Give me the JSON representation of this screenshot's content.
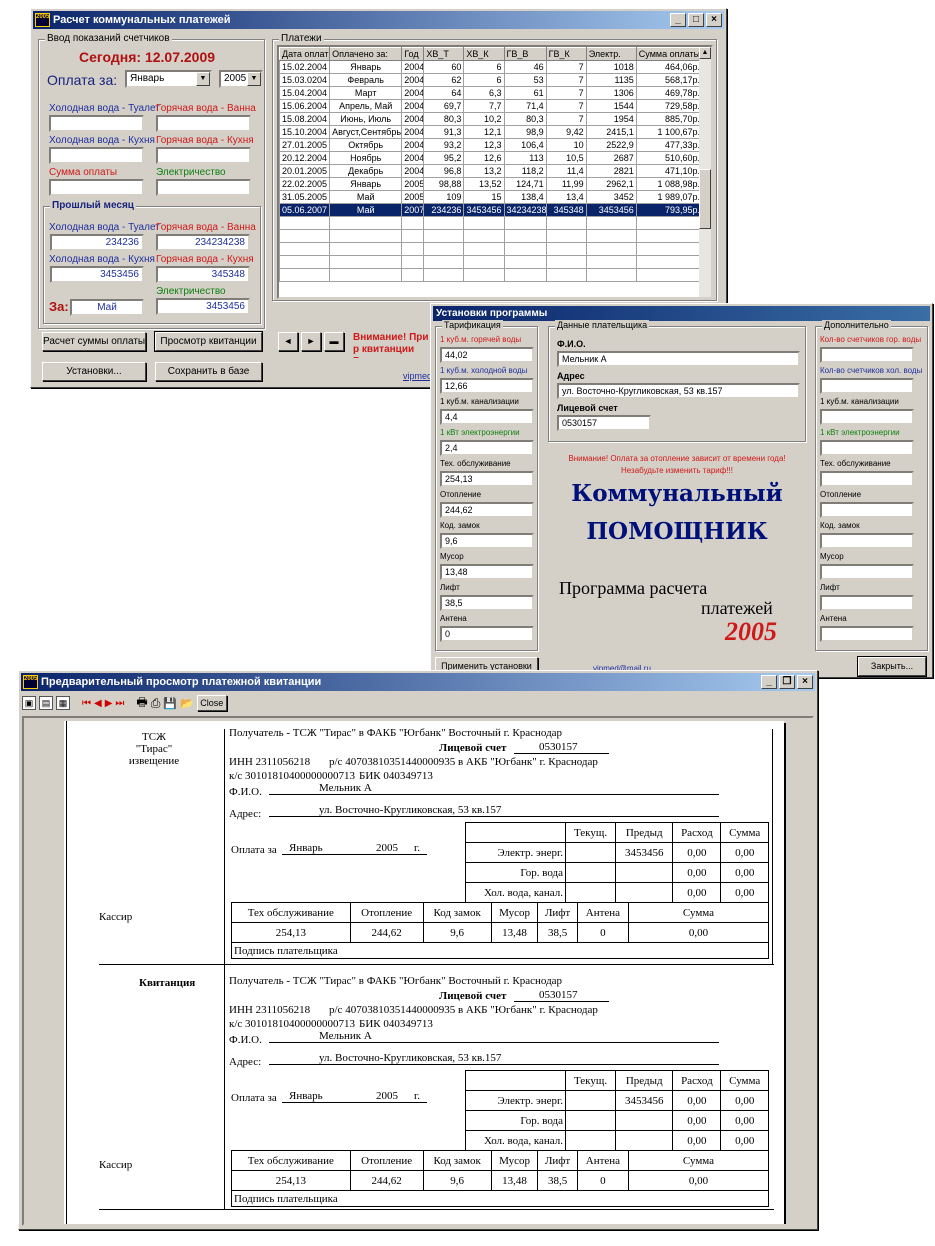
{
  "main_window": {
    "title": "Расчет коммунальных платежей",
    "icon_text": "2005",
    "input_group": {
      "title": "Ввод показаний счетчиков",
      "today": "Сегодня: 12.07.2009",
      "pay_for_label": "Оплата за:",
      "month_value": "Январь",
      "year_value": "2005",
      "cold_toilet": "Холодная вода - Туалет",
      "hot_bath": "Горячая вода - Ванна",
      "cold_kitchen": "Холодная вода - Кухня",
      "hot_kitchen": "Горячая вода - Кухня",
      "sum": "Сумма оплаты",
      "electricity": "Электричество"
    },
    "prev_group": {
      "title": "Прошлый месяц",
      "cold_toilet": "Холодная вода - Туалет",
      "cold_toilet_value": "234236",
      "hot_bath": "Горячая вода - Ванна",
      "hot_bath_value": "234234238",
      "cold_kitchen": "Холодная вода - Кухня",
      "cold_kitchen_value": "3453456",
      "hot_kitchen": "Горячая вода - Кухня",
      "hot_kitchen_value": "345348",
      "electricity": "Электричество",
      "electricity_value": "3453456",
      "for_label": "За:",
      "for_value": "Май"
    },
    "buttons": {
      "calc": "Расчет суммы оплаты",
      "view": "Просмотр квитанции",
      "settings": "Установки...",
      "save": "Сохранить в базе"
    },
    "payments": {
      "title": "Платежи",
      "columns": [
        "Дата оплаты",
        "Оплачено за:",
        "Год",
        "ХВ_Т",
        "ХВ_К",
        "ГВ_В",
        "ГВ_К",
        "Электр.",
        "Сумма оплаты"
      ],
      "rows": [
        [
          "15.02.2004",
          "Январь",
          "2004",
          "60",
          "6",
          "46",
          "7",
          "1018",
          "464,06р."
        ],
        [
          "15.03.0204",
          "Февраль",
          "2004",
          "62",
          "6",
          "53",
          "7",
          "1135",
          "568,17р."
        ],
        [
          "15.04.2004",
          "Март",
          "2004",
          "64",
          "6,3",
          "61",
          "7",
          "1306",
          "469,78р."
        ],
        [
          "15.06.2004",
          "Апрель, Май",
          "2004",
          "69,7",
          "7,7",
          "71,4",
          "7",
          "1544",
          "729,58р."
        ],
        [
          "15.08.2004",
          "Июнь, Июль",
          "2004",
          "80,3",
          "10,2",
          "80,3",
          "7",
          "1954",
          "885,70р."
        ],
        [
          "15.10.2004",
          "Август,Сентябрь",
          "2004",
          "91,3",
          "12,1",
          "98,9",
          "9,42",
          "2415,1",
          "1 100,67р."
        ],
        [
          "27.01.2005",
          "Октябрь",
          "2004",
          "93,2",
          "12,3",
          "106,4",
          "10",
          "2522,9",
          "477,33р."
        ],
        [
          "20.12.2004",
          "Ноябрь",
          "2004",
          "95,2",
          "12,6",
          "113",
          "10,5",
          "2687",
          "510,60р."
        ],
        [
          "20.01.2005",
          "Декабрь",
          "2004",
          "96,8",
          "13,2",
          "118,2",
          "11,4",
          "2821",
          "471,10р."
        ],
        [
          "22.02.2005",
          "Январь",
          "2005",
          "98,88",
          "13,52",
          "124,71",
          "11,99",
          "2962,1",
          "1 088,98р."
        ],
        [
          "31.05.2005",
          "Май",
          "2005",
          "109",
          "15",
          "138,4",
          "13,4",
          "3452",
          "1 989,07р."
        ],
        [
          "05.06.2007",
          "Май",
          "2007",
          "234236",
          "3453456",
          "34234238",
          "345348",
          "3453456",
          "793,95р."
        ]
      ],
      "selected_row": 11
    },
    "nav": {
      "prev": "◄",
      "next": "►",
      "delete": "▬"
    },
    "warning": "Внимание! При р квитанции Выдел",
    "email_fragment": "vipmed"
  },
  "settings_window": {
    "title": "Установки программы",
    "tariff": {
      "title": "Тарификация",
      "items": [
        {
          "label": "1 куб.м. горячей воды",
          "value": "44,02",
          "color": "red"
        },
        {
          "label": "1 куб.м. холодной воды",
          "value": "12,66",
          "color": "blue"
        },
        {
          "label": "1 куб.м. канализации",
          "value": "4,4",
          "color": "black"
        },
        {
          "label": "1 кВт электроэнергии",
          "value": "2,4",
          "color": "green"
        },
        {
          "label": "Тех. обслуживание",
          "value": "254,13",
          "color": "black"
        },
        {
          "label": "Отопление",
          "value": "244,62",
          "color": "black"
        },
        {
          "label": "Код. замок",
          "value": "9,6",
          "color": "black"
        },
        {
          "label": "Мусор",
          "value": "13,48",
          "color": "black"
        },
        {
          "label": "Лифт",
          "value": "38,5",
          "color": "black"
        },
        {
          "label": "Антена",
          "value": "0",
          "color": "black"
        }
      ]
    },
    "payer": {
      "title": "Данные плательщика",
      "fio_label": "Ф.И.О.",
      "fio": "Мельник А",
      "address_label": "Адрес",
      "address": "ул. Восточно-Кругликовская, 53 кв.157",
      "account_label": "Лицевой счет",
      "account": "0530157"
    },
    "notice1": "Внимание! Оплата за отопление зависит от времени года!",
    "notice2": "Незабудьте изменить тариф!!!",
    "brand1": "Коммунальный",
    "brand2": "ПОМОЩНИК",
    "prog1": "Программа расчета",
    "prog2": "платежей",
    "year": "2005",
    "extra": {
      "title": "Дополнительно",
      "items": [
        {
          "label": "Кол-во счетчиков гор. воды",
          "color": "red"
        },
        {
          "label": "Кол-во счетчиков хол. воды",
          "color": "blue"
        },
        {
          "label": "1 куб.м. канализации",
          "color": "black"
        },
        {
          "label": "1 кВт электроэнергии",
          "color": "green"
        },
        {
          "label": "Тех. обслуживание",
          "color": "black"
        },
        {
          "label": "Отопление",
          "color": "black"
        },
        {
          "label": "Код. замок",
          "color": "black"
        },
        {
          "label": "Мусор",
          "color": "black"
        },
        {
          "label": "Лифт",
          "color": "black"
        },
        {
          "label": "Антена",
          "color": "black"
        }
      ]
    },
    "apply_button": "Применить установки",
    "email": "vipmed@mail.ru",
    "close_button": "Закрыть..."
  },
  "preview_window": {
    "title": "Предварительный просмотр платежной квитанции",
    "close_button": "Close",
    "receipt": {
      "org1": "ТСЖ",
      "org2": "\"Тирас\"",
      "notice": "извещение",
      "cashier": "Кассир",
      "kvit": "Квитанция",
      "recipient": "Получатель - ТСЖ \"Тирас\" в ФАКБ \"Югбанк\" Восточный г. Краснодар",
      "account_label": "Лицевой счет",
      "account": "0530157",
      "inn": "ИНН 2311056218",
      "rs": "р/с 40703810351440000935 в АКБ \"Югбанк\" г. Краснодар",
      "ks": "к/с 30101810400000000713",
      "bik": "БИК 040349713",
      "fio_label": "Ф.И.О.",
      "fio": "Мельник А",
      "addr_label": "Адрес:",
      "addr": "ул. Восточно-Кругликовская, 53 кв.157",
      "pay_for": "Оплата за",
      "month": "Январь",
      "year": "2005",
      "g": "г.",
      "meter_headers": [
        "Текущ.",
        "Предыд",
        "Расход",
        "Сумма"
      ],
      "meter_rows": [
        {
          "name": "Электр. энерг.",
          "cur": "",
          "prev": "3453456",
          "use": "0,00",
          "sum": "0,00"
        },
        {
          "name": "Гор. вода",
          "cur": "",
          "prev": "",
          "use": "0,00",
          "sum": "0,00"
        },
        {
          "name": "Хол. вода, канал.",
          "cur": "",
          "prev": "",
          "use": "0,00",
          "sum": "0,00"
        }
      ],
      "fee_headers": [
        "Тех обслуживание",
        "Отопление",
        "Код замок",
        "Мусор",
        "Лифт",
        "Антена",
        "Сумма"
      ],
      "fee_values": [
        "254,13",
        "244,62",
        "9,6",
        "13,48",
        "38,5",
        "0",
        "0,00"
      ],
      "signature": "Подпись плательщика"
    }
  }
}
